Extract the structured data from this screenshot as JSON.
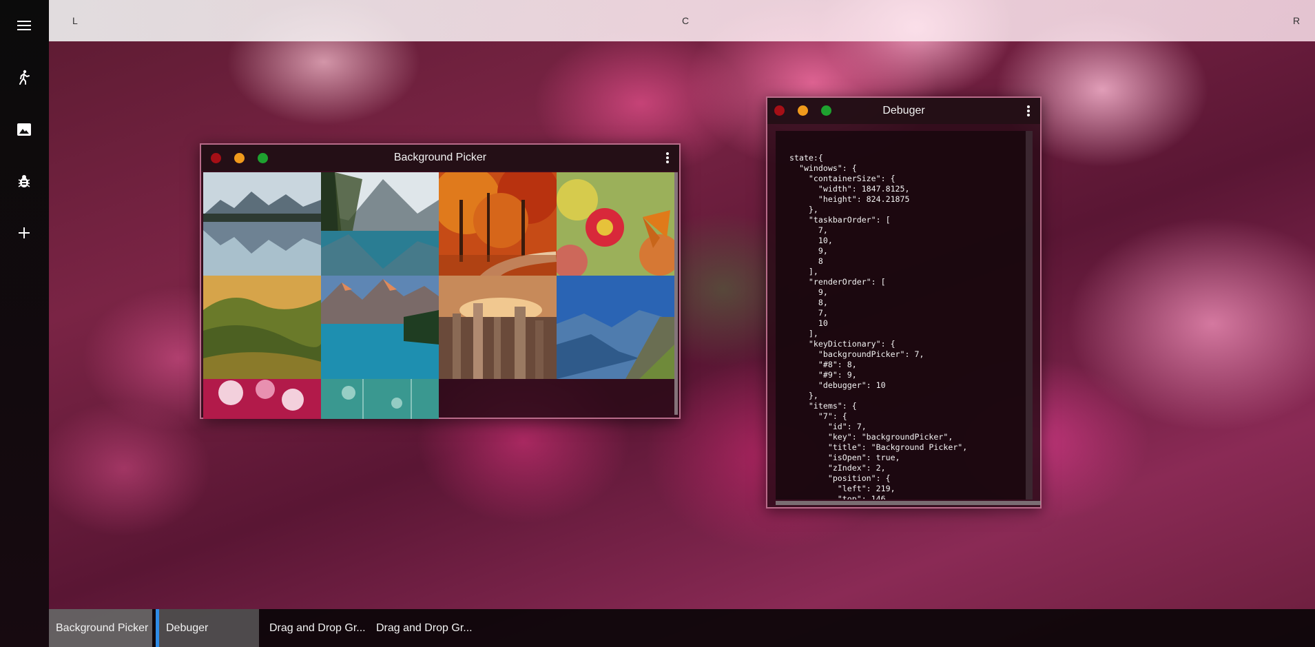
{
  "topbar": {
    "left": "L",
    "center": "C",
    "right": "R"
  },
  "sidebar": {
    "items": [
      "menu-icon",
      "walk-icon",
      "image-icon",
      "bug-icon",
      "plus-icon"
    ]
  },
  "windows": {
    "background_picker": {
      "title": "Background Picker",
      "thumbnails": [
        "mountain lake reflection",
        "alpine lake with pines",
        "autumn forest path",
        "flower with butterfly",
        "rolling vineyard hills",
        "turquoise mountain lake",
        "city skyline at sunset",
        "blue mountain valley",
        "pink blossoms",
        "blue-green bokeh"
      ]
    },
    "debugger": {
      "title": "Debuger",
      "state_text": "state:{\n  \"windows\": {\n    \"containerSize\": {\n      \"width\": 1847.8125,\n      \"height\": 824.21875\n    },\n    \"taskbarOrder\": [\n      7,\n      10,\n      9,\n      8\n    ],\n    \"renderOrder\": [\n      9,\n      8,\n      7,\n      10\n    ],\n    \"keyDictionary\": {\n      \"backgroundPicker\": 7,\n      \"#8\": 8,\n      \"#9\": 9,\n      \"debugger\": 10\n    },\n    \"items\": {\n      \"7\": {\n        \"id\": 7,\n        \"key\": \"backgroundPicker\",\n        \"title\": \"Background Picker\",\n        \"isOpen\": true,\n        \"zIndex\": 2,\n        \"position\": {\n          \"left\": 219,\n          \"top\": 146"
    }
  },
  "taskbar": {
    "items": [
      {
        "label": "Background Picker"
      },
      {
        "label": "Debuger"
      },
      {
        "label": "Drag and Drop Gr..."
      },
      {
        "label": "Drag and Drop Gr..."
      }
    ]
  },
  "colors": {
    "close": "#a50f16",
    "minimize": "#f09a1c",
    "maximize": "#1ea12f",
    "accent": "#2e8be6"
  }
}
